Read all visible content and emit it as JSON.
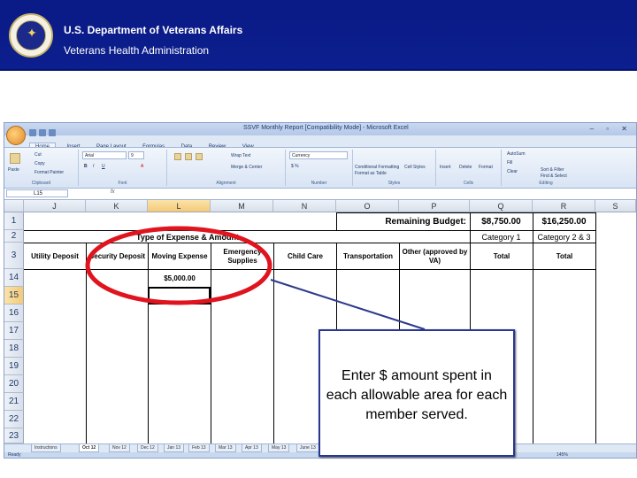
{
  "banner": {
    "line1": "U.S. Department of Veterans Affairs",
    "line2": "Veterans Health Administration",
    "bg_color": "#0a1a86",
    "seal_icon": "va-seal-icon"
  },
  "excel": {
    "window_title": "SSVF Monthly Report [Compatibility Mode] - Microsoft Excel",
    "window_controls": "– ▫ ✕",
    "tabs": [
      "Home",
      "Insert",
      "Page Layout",
      "Formulas",
      "Data",
      "Review",
      "View"
    ],
    "ribbon": {
      "paste": "Paste",
      "cut": "Cut",
      "copy": "Copy",
      "format_painter": "Format Painter",
      "font_name": "Arial",
      "font_size": "9",
      "wrap_text": "Wrap Text",
      "merge_center": "Merge & Center",
      "number_format": "Currency",
      "conditional_formatting": "Conditional Formatting",
      "format_as_table": "Format as Table",
      "cell_styles": "Cell Styles",
      "insert": "Insert",
      "delete": "Delete",
      "format": "Format",
      "autosum": "AutoSum",
      "fill": "Fill",
      "clear": "Clear",
      "sort_filter": "Sort & Filter",
      "find_select": "Find & Select",
      "groups": [
        "Clipboard",
        "Font",
        "Alignment",
        "Number",
        "Styles",
        "Cells",
        "Editing"
      ]
    },
    "name_box": "L15",
    "fx_label": "fx",
    "columns": [
      "J",
      "K",
      "L",
      "M",
      "N",
      "O",
      "P",
      "Q",
      "R",
      "S"
    ],
    "rows": [
      "1",
      "2",
      "3",
      "14",
      "15",
      "16",
      "17",
      "18",
      "19",
      "20",
      "21",
      "22",
      "23"
    ],
    "cells": {
      "remaining_budget_label": "Remaining Budget:",
      "q1_value": "$8,750.00",
      "r1_value": "$16,250.00",
      "category_1": "Category 1",
      "category_2_3": "Category 2 & 3",
      "type_of_expense": "Type of Expense & Amount",
      "utility_deposit": "Utility Deposit",
      "security_deposit": "Security Deposit",
      "moving_expense": "Moving Expense",
      "emergency_supplies": "Emergency Supplies",
      "child_care": "Child Care",
      "transportation": "Transportation",
      "other": "Other (approved by VA)",
      "total_q": "Total",
      "total_r": "Total",
      "moving_amount": "$5,000.00"
    },
    "sheet_tabs": [
      "Instructions",
      "Oct 12",
      "Nov 12",
      "Dec 12",
      "Jan 13",
      "Feb 13",
      "Mar 13",
      "Apr 13",
      "May 13",
      "June 13"
    ],
    "status": "Ready",
    "zoom": "145%"
  },
  "callout": {
    "text": "Enter $ amount spent in each allowable area for each member served."
  },
  "colors": {
    "highlight_ellipse": "#e0141e",
    "pointer_line": "#2c3a8c",
    "callout_border": "#283593"
  }
}
